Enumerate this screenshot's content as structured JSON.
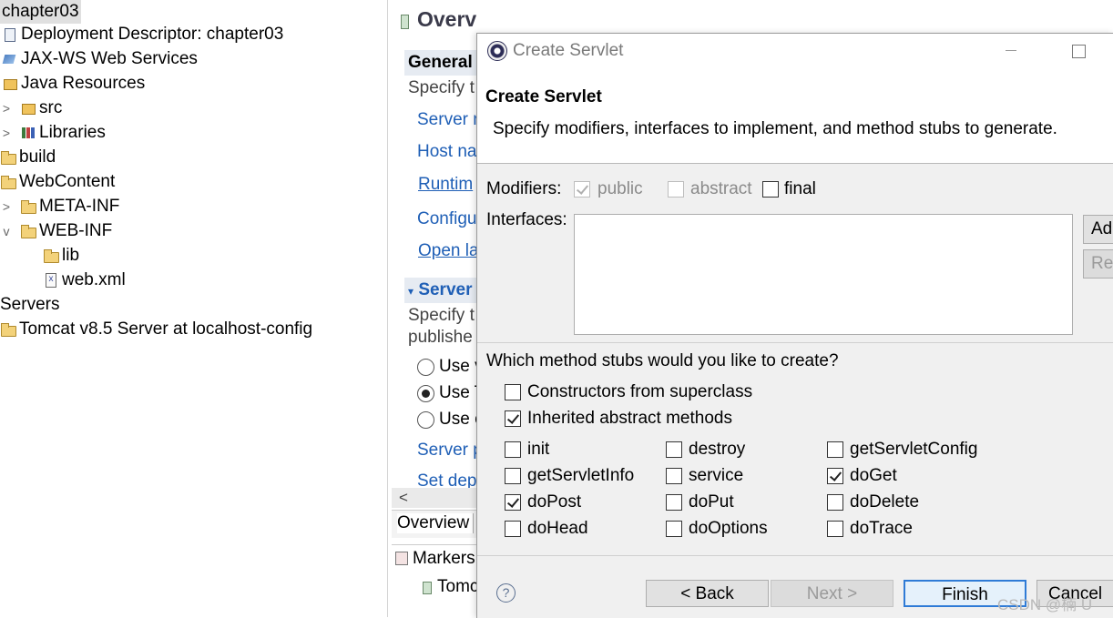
{
  "tree": {
    "items": [
      {
        "label": "chapter03"
      },
      {
        "label": "Deployment Descriptor: chapter03"
      },
      {
        "label": "JAX-WS Web Services"
      },
      {
        "label": "Java Resources"
      },
      {
        "label": "src"
      },
      {
        "label": "Libraries"
      },
      {
        "label": "build"
      },
      {
        "label": "WebContent"
      },
      {
        "label": "META-INF"
      },
      {
        "label": "WEB-INF"
      },
      {
        "label": "lib"
      },
      {
        "label": "web.xml"
      },
      {
        "label": "Servers"
      },
      {
        "label": "Tomcat v8.5 Server at localhost-config"
      }
    ],
    "twisty_collapsed": ">",
    "twisty_expanded": "v"
  },
  "editor": {
    "title": "Overview",
    "general_section": "General",
    "specify1": "Specify t",
    "server_name": "Server n",
    "host_name": "Host na",
    "runtime": "Runtim",
    "configuration": "Configu",
    "open_launch": "Open la",
    "server_section": "Server",
    "specify2": "Specify t",
    "publish": "publishe",
    "use1": "Use v",
    "use2": "Use T",
    "use3": "Use c",
    "server_path": "Server p",
    "set_deploy": "Set dep",
    "scroll_left": "<",
    "tab_overview": "Overview",
    "markers": "Markers",
    "markers_row": "Tomc"
  },
  "dialog": {
    "window_title": "Create Servlet",
    "header_title": "Create Servlet",
    "header_desc": "Specify modifiers, interfaces to implement, and method stubs to generate.",
    "modifiers_label": "Modifiers:",
    "mod_public": "public",
    "mod_abstract": "abstract",
    "mod_final": "final",
    "interfaces_label": "Interfaces:",
    "add_button": "Add...",
    "remove_button": "Remove",
    "stubs_question": "Which method stubs would you like to create?",
    "constructors": "Constructors from superclass",
    "inherited": "Inherited abstract methods",
    "methods": {
      "init": "init",
      "destroy": "destroy",
      "getServletConfig": "getServletConfig",
      "getServletInfo": "getServletInfo",
      "service": "service",
      "doGet": "doGet",
      "doPost": "doPost",
      "doPut": "doPut",
      "doDelete": "doDelete",
      "doHead": "doHead",
      "doOptions": "doOptions",
      "doTrace": "doTrace"
    },
    "help": "?",
    "back": "< Back",
    "next": "Next >",
    "finish": "Finish",
    "cancel": "Cancel"
  },
  "watermark": "CSDN @楠 Ü"
}
